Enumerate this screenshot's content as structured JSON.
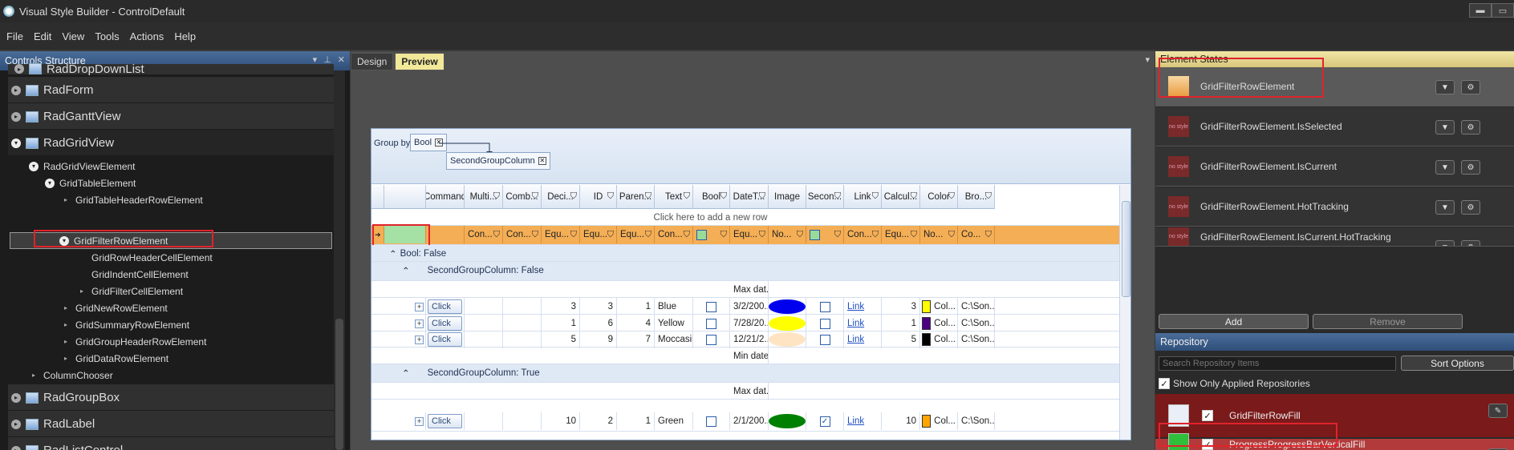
{
  "window": {
    "title": "Visual Style Builder - ControlDefault",
    "min": "▬",
    "max": "▭"
  },
  "menu": [
    "File",
    "Edit",
    "View",
    "Tools",
    "Actions",
    "Help"
  ],
  "controls_panel": {
    "title": "Controls Structure",
    "pin": "▾",
    "lock": "⊥",
    "close": "✕",
    "top_cut": "RadDropDownList",
    "nodes": [
      "RadForm",
      "RadGanttView",
      "RadGridView"
    ],
    "sub": [
      "RadGridViewElement",
      "GridTableElement",
      "GridTableHeaderRowElement",
      "GridFilterRowElement",
      "GridRowHeaderCellElement",
      "GridIndentCellElement",
      "GridFilterCellElement",
      "GridNewRowElement",
      "GridSummaryRowElement",
      "GridGroupHeaderRowElement",
      "GridDataRowElement",
      "ColumnChooser"
    ],
    "nodes2": [
      "RadGroupBox",
      "RadLabel",
      "RadListControl"
    ]
  },
  "design_tabs": [
    "Design",
    "Preview"
  ],
  "grid": {
    "group_by_label": "Group by:",
    "chip1": "Bool",
    "chip2": "SecondGroupColumn",
    "headers": [
      "Command",
      "Multi...",
      "Comb...",
      "Deci...",
      "ID",
      "Paren...",
      "Text",
      "Bool",
      "DateT...",
      "Image",
      "Secon...",
      "Link",
      "Calcul...",
      "Color",
      "Bro..."
    ],
    "new_row": "Click here to add a new row",
    "filters": [
      "Con...",
      "Con...",
      "Equ...",
      "Equ...",
      "Equ...",
      "Con...",
      "",
      "Equ...",
      "No...",
      "",
      "Con...",
      "Equ...",
      "No...",
      "Co..."
    ],
    "group_bool": "Bool: False",
    "group_second_false": "SecondGroupColumn: False",
    "group_second_true": "SecondGroupColumn: True",
    "max_date": "Max dat...",
    "min_date": "Min date...",
    "rows": [
      {
        "cmd": "Click",
        "dec": "3",
        "id": "3",
        "parent": "1",
        "text": "Blue",
        "date": "3/2/200...",
        "oval": "#0000ee",
        "sec": false,
        "link": "Link",
        "calc": "3",
        "color": "#ffff00",
        "colortxt": "Col...",
        "path": "C:\\Son..."
      },
      {
        "cmd": "Click",
        "dec": "1",
        "id": "6",
        "parent": "4",
        "text": "Yellow",
        "date": "7/28/20...",
        "oval": "#ffff00",
        "sec": false,
        "link": "Link",
        "calc": "1",
        "color": "#4b0082",
        "colortxt": "Col...",
        "path": "C:\\Son..."
      },
      {
        "cmd": "Click",
        "dec": "5",
        "id": "9",
        "parent": "7",
        "text": "Moccasin",
        "date": "12/21/2...",
        "oval": "#ffe4c4",
        "sec": false,
        "link": "Link",
        "calc": "5",
        "color": "#000000",
        "colortxt": "Col...",
        "path": "C:\\Son..."
      },
      {
        "cmd": "Click",
        "dec": "10",
        "id": "2",
        "parent": "1",
        "text": "Green",
        "date": "2/1/200...",
        "oval": "#008000",
        "sec": true,
        "link": "Link",
        "calc": "10",
        "color": "#ffa500",
        "colortxt": "Col...",
        "path": "C:\\Son..."
      }
    ]
  },
  "element_states": {
    "title": "Element States",
    "states": [
      "GridFilterRowElement",
      "GridFilterRowElement.IsSelected",
      "GridFilterRowElement.IsCurrent",
      "GridFilterRowElement.HotTracking",
      "GridFilterRowElement.IsCurrent.HotTracking"
    ],
    "no_style": "no style",
    "add": "Add",
    "remove": "Remove"
  },
  "repository": {
    "title": "Repository",
    "search_placeholder": "Search Repository Items",
    "sort_options": "Sort Options",
    "show_only": "Show Only Applied Repositories",
    "items": [
      {
        "name": "GridFilterRowFill",
        "swatch": "#e9eef7"
      },
      {
        "name": "ProgressProgressBarVerticalFill",
        "swatch": "#2fbf3a"
      }
    ]
  },
  "colors": {
    "accent_red": "#e0232c",
    "filter_row": "#f4ae55",
    "repo_row1": "#7a1a1a",
    "repo_row2": "#b23a3a"
  }
}
